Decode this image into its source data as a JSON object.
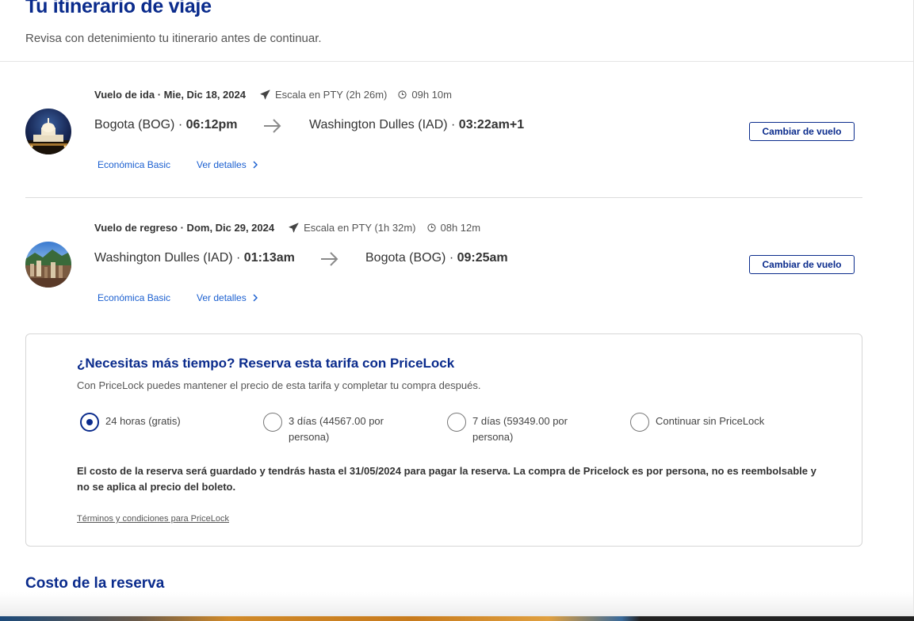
{
  "header": {
    "title": "Tu itinerario de viaje",
    "subtitle": "Revisa con detenimiento tu itinerario antes de continuar."
  },
  "flights": [
    {
      "direction_date": "Vuelo de ida · Mie, Dic 18, 2024",
      "stop": "Escala en PTY (2h 26m)",
      "duration": "09h 10m",
      "origin_city": "Bogota (BOG)",
      "origin_time": "06:12pm",
      "dest_city": "Washington Dulles (IAD)",
      "dest_time": "03:22am+1",
      "fare": "Económica Basic",
      "details_label": "Ver detalles",
      "change_label": "Cambiar de vuelo",
      "image_icon": "capitol-night-icon"
    },
    {
      "direction_date": "Vuelo de regreso · Dom, Dic 29, 2024",
      "stop": "Escala en PTY (1h 32m)",
      "duration": "08h 12m",
      "origin_city": "Washington Dulles (IAD)",
      "origin_time": "01:13am",
      "dest_city": "Bogota (BOG)",
      "dest_time": "09:25am",
      "fare": "Económica Basic",
      "details_label": "Ver detalles",
      "change_label": "Cambiar de vuelo",
      "image_icon": "bogota-city-icon"
    }
  ],
  "pricelock": {
    "title": "¿Necesitas más tiempo? Reserva esta tarifa con PriceLock",
    "description": "Con PriceLock puedes mantener el precio de esta tarifa y completar tu compra después.",
    "options": [
      {
        "line1": "24 horas (gratis)",
        "line2": "",
        "checked": true
      },
      {
        "line1": "3 días (44567.00 por",
        "line2": "persona)",
        "checked": false
      },
      {
        "line1": "7 días (59349.00 por",
        "line2": "persona)",
        "checked": false
      },
      {
        "line1": "Continuar sin PriceLock",
        "line2": "",
        "checked": false
      }
    ],
    "note": "El costo de la reserva será guardado y tendrás hasta el 31/05/2024 para pagar la reserva. La compra de Pricelock es por persona, no es reembolsable y no se aplica al precio del boleto.",
    "terms": "Términos y condiciones para PriceLock"
  },
  "cost": {
    "title": "Costo de la reserva"
  },
  "colors": {
    "brand_blue": "#0a2b8c",
    "link_blue": "#1a5fd0"
  }
}
